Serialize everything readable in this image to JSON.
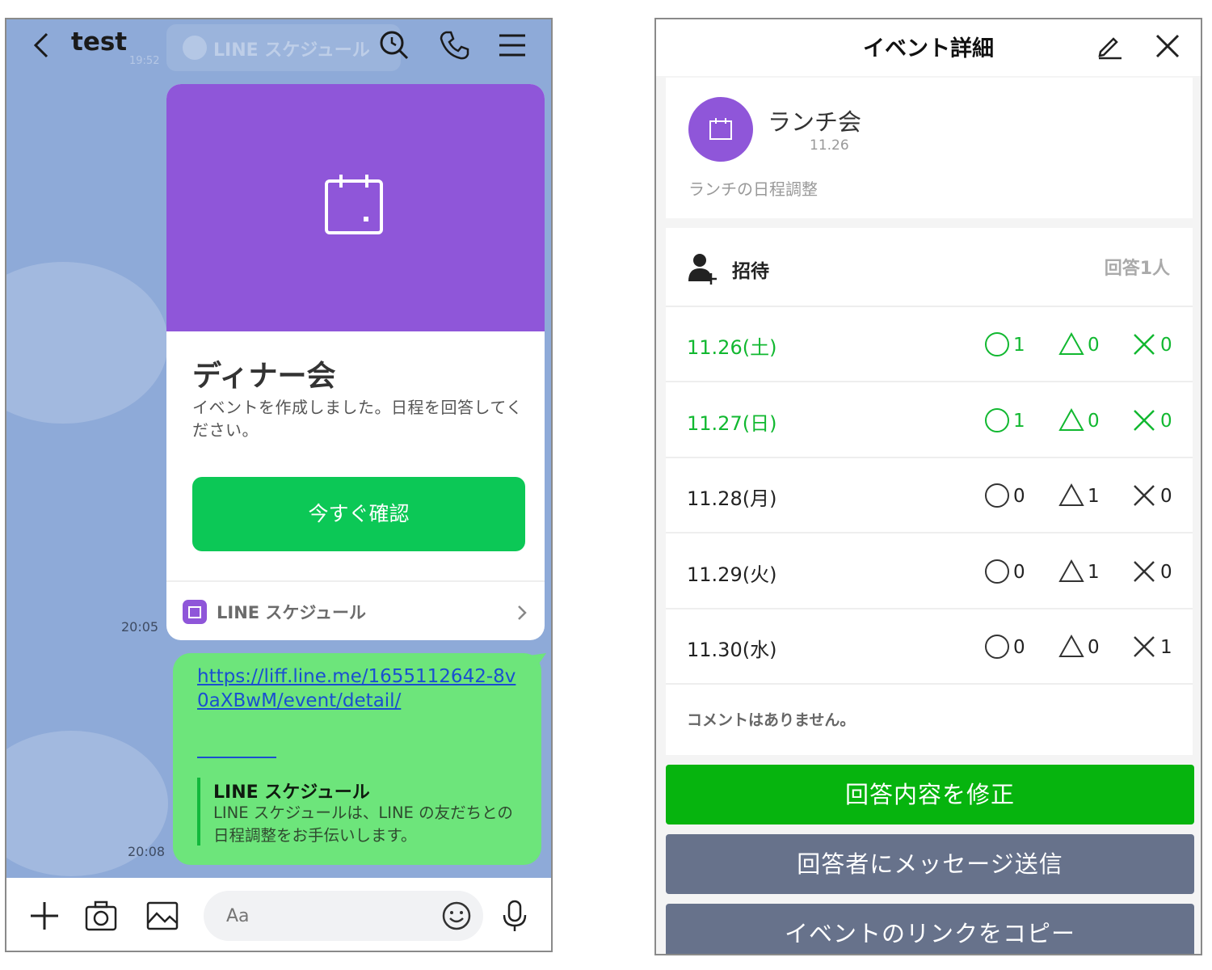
{
  "chat": {
    "title": "test",
    "ghost_header_label": "LINE スケジュール",
    "ghost_time": "19:52",
    "card": {
      "title": "ディナー会",
      "description": "イベントを作成しました。日程を回答してください。",
      "button_label": "今すぐ確認",
      "footer_label": "LINE スケジュール",
      "time": "20:05"
    },
    "message": {
      "link": "https://liff.line.me/1655112642-8v0aXBwM/event/detail/",
      "preview_title": "LINE スケジュール",
      "preview_description": "LINE スケジュールは、LINE の友だちとの日程調整をお手伝いします。",
      "time": "20:08"
    },
    "input_placeholder": "Aa",
    "icons": [
      "back-icon",
      "search-icon",
      "phone-icon",
      "menu-icon",
      "plus-icon",
      "camera-icon",
      "image-icon",
      "smile-icon",
      "mic-icon",
      "calendar-icon",
      "chevron-right-icon"
    ]
  },
  "detail": {
    "header_title": "イベント詳細",
    "event": {
      "name": "ランチ会",
      "date": "11.26",
      "description": "ランチの日程調整"
    },
    "invite_label": "招待",
    "answer_count": "回答1人",
    "rows": [
      {
        "date": "11.26(土)",
        "ok": "1",
        "maybe": "0",
        "ng": "0",
        "highlight": true
      },
      {
        "date": "11.27(日)",
        "ok": "1",
        "maybe": "0",
        "ng": "0",
        "highlight": true
      },
      {
        "date": "11.28(月)",
        "ok": "0",
        "maybe": "1",
        "ng": "0",
        "highlight": false
      },
      {
        "date": "11.29(火)",
        "ok": "0",
        "maybe": "1",
        "ng": "0",
        "highlight": false
      },
      {
        "date": "11.30(水)",
        "ok": "0",
        "maybe": "0",
        "ng": "1",
        "highlight": false
      }
    ],
    "no_comment": "コメントはありません。",
    "buttons": {
      "edit_answer": "回答内容を修正",
      "message_respondents": "回答者にメッセージ送信",
      "copy_link": "イベントのリンクをコピー"
    },
    "colors": {
      "accent_green": "#11b830",
      "brand_purple": "#8f56d9",
      "button_green": "#06b40e",
      "button_grey": "#67728b"
    }
  }
}
